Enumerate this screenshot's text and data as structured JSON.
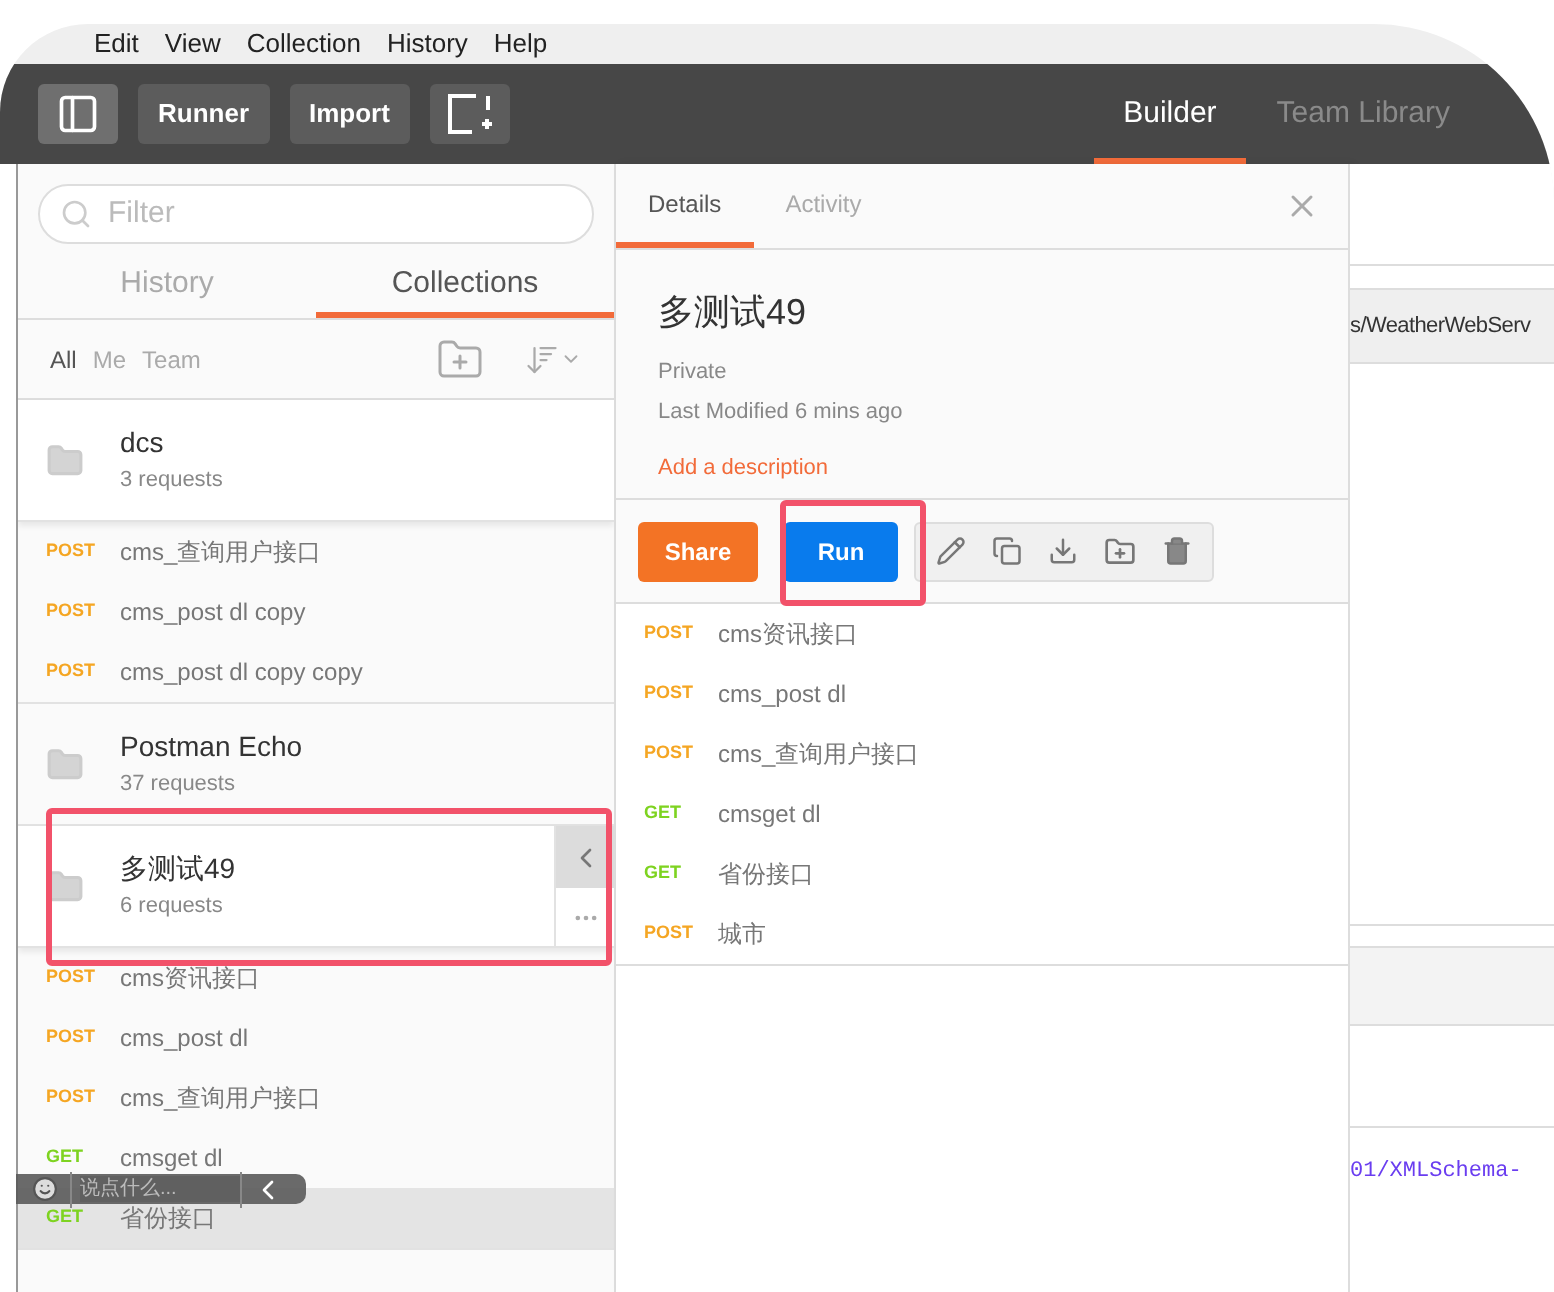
{
  "menu": [
    "Edit",
    "View",
    "Collection",
    "History",
    "Help"
  ],
  "toolbar": {
    "buttons": [
      {
        "kind": "sidebar-toggle"
      },
      {
        "kind": "text",
        "label": "Runner"
      },
      {
        "kind": "text",
        "label": "Import"
      },
      {
        "kind": "new-window"
      }
    ],
    "tabs": [
      {
        "label": "Builder",
        "selected": true
      },
      {
        "label": "Team Library",
        "selected": false
      }
    ]
  },
  "sidebar": {
    "filter": {
      "placeholder": "Filter"
    },
    "tabs": [
      {
        "label": "History",
        "selected": false
      },
      {
        "label": "Collections",
        "selected": true
      }
    ],
    "owner_filters": [
      {
        "label": "All",
        "selected": true
      },
      {
        "label": "Me",
        "selected": false
      },
      {
        "label": "Team",
        "selected": false
      }
    ],
    "collections": [
      {
        "name": "dcs",
        "count": "3 requests",
        "active": false,
        "annotated": false,
        "requests": [
          {
            "method": "POST",
            "name": "cms_查询用户接口",
            "highlighted": false
          },
          {
            "method": "POST",
            "name": "cms_post dl copy",
            "highlighted": false
          },
          {
            "method": "POST",
            "name": "cms_post dl copy copy",
            "highlighted": false
          }
        ]
      },
      {
        "name": "Postman Echo",
        "count": "37 requests",
        "active": false,
        "annotated": false
      },
      {
        "name": "多测试49",
        "count": "6 requests",
        "active": true,
        "annotated": true,
        "requests": [
          {
            "method": "POST",
            "name": "cms资讯接口",
            "highlighted": false
          },
          {
            "method": "POST",
            "name": "cms_post dl",
            "highlighted": false
          },
          {
            "method": "POST",
            "name": "cms_查询用户接口",
            "highlighted": false
          },
          {
            "method": "GET",
            "name": "cmsget dl",
            "highlighted": false
          },
          {
            "method": "GET",
            "name": "省份接口",
            "highlighted": true
          }
        ]
      }
    ]
  },
  "details": {
    "tabs": [
      {
        "label": "Details",
        "selected": true
      },
      {
        "label": "Activity",
        "selected": false
      }
    ],
    "title": "多测试49",
    "visibility": "Private",
    "modified": "Last Modified 6 mins ago",
    "description_link": "Add a description",
    "actions": [
      {
        "kind": "share",
        "label": "Share",
        "annotated": false
      },
      {
        "kind": "run",
        "label": "Run",
        "annotated": true
      }
    ],
    "tools": [
      {
        "kind": "edit"
      },
      {
        "kind": "duplicate"
      },
      {
        "kind": "download"
      },
      {
        "kind": "add-folder"
      },
      {
        "kind": "delete"
      }
    ],
    "requests": [
      {
        "method": "POST",
        "name": "cms资讯接口"
      },
      {
        "method": "POST",
        "name": "cms_post dl"
      },
      {
        "method": "POST",
        "name": "cms_查询用户接口"
      },
      {
        "method": "GET",
        "name": "cmsget dl"
      },
      {
        "method": "GET",
        "name": "省份接口"
      },
      {
        "method": "POST",
        "name": "城市"
      }
    ]
  },
  "background": {
    "url_fragment": "s/WeatherWebServ",
    "code_fragment": "01/XMLSchema-"
  },
  "comment_bar": {
    "placeholder": "说点什么..."
  }
}
